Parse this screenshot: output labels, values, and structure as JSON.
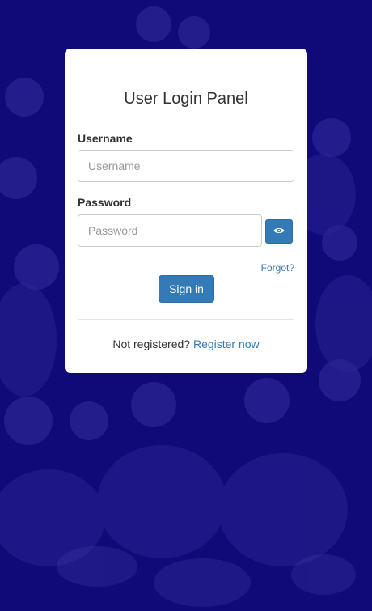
{
  "login_panel": {
    "title": "User Login Panel",
    "username": {
      "label": "Username",
      "placeholder": "Username",
      "value": ""
    },
    "password": {
      "label": "Password",
      "placeholder": "Password",
      "value": "",
      "toggle_icon": "eye-icon"
    },
    "forgot_label": "Forgot?",
    "signin_label": "Sign in",
    "register_prompt": "Not registered?",
    "register_link": "Register now"
  },
  "colors": {
    "background": "#100a78",
    "primary": "#337ab7",
    "panel": "#ffffff",
    "text": "#333333"
  }
}
